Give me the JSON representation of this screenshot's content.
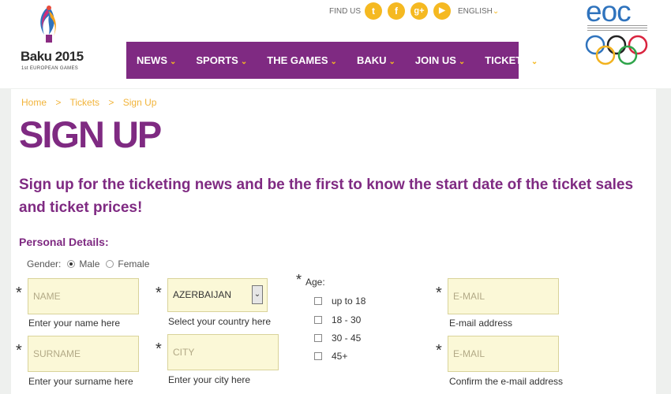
{
  "logo": {
    "name": "Baku 2015",
    "subtitle": "1st EUROPEAN GAMES"
  },
  "header": {
    "find_us": "FIND US",
    "social": [
      {
        "icon": "twitter-icon",
        "glyph": "t"
      },
      {
        "icon": "facebook-icon",
        "glyph": "f"
      },
      {
        "icon": "google-plus-icon",
        "glyph": "g+"
      },
      {
        "icon": "youtube-icon",
        "glyph": "▶"
      }
    ],
    "language": "ENGLISH",
    "eoc": "eoc"
  },
  "nav": {
    "items": [
      "NEWS",
      "SPORTS",
      "THE GAMES",
      "BAKU",
      "JOIN US",
      "TICKETS"
    ]
  },
  "breadcrumb": [
    "Home",
    ">",
    "Tickets",
    ">",
    "Sign Up"
  ],
  "page": {
    "title": "SIGN UP",
    "lead": "Sign up for the ticketing news and be the first to know the start date of the ticket sales and ticket prices!"
  },
  "form": {
    "section": "Personal Details:",
    "gender": {
      "label": "Gender:",
      "options": [
        "Male",
        "Female"
      ],
      "selected": "Male"
    },
    "name": {
      "placeholder": "NAME",
      "hint": "Enter your name here"
    },
    "surname": {
      "placeholder": "SURNAME",
      "hint": "Enter your surname here"
    },
    "country": {
      "value": "AZERBAIJAN",
      "hint": "Select your country here"
    },
    "city": {
      "placeholder": "CITY",
      "hint": "Enter your city here"
    },
    "age": {
      "label": "Age:",
      "options": [
        "up to 18",
        "18 - 30",
        "30 - 45",
        "45+"
      ]
    },
    "email": {
      "placeholder": "E-MAIL",
      "hint": "E-mail address"
    },
    "email_confirm": {
      "placeholder": "E-MAIL",
      "hint": "Confirm the e-mail address"
    },
    "required_marker": "*"
  },
  "colors": {
    "brand_purple": "#7f2a82",
    "accent_yellow": "#f5b921",
    "field_bg": "#fbf8d7",
    "eoc_blue": "#2f73bd"
  }
}
